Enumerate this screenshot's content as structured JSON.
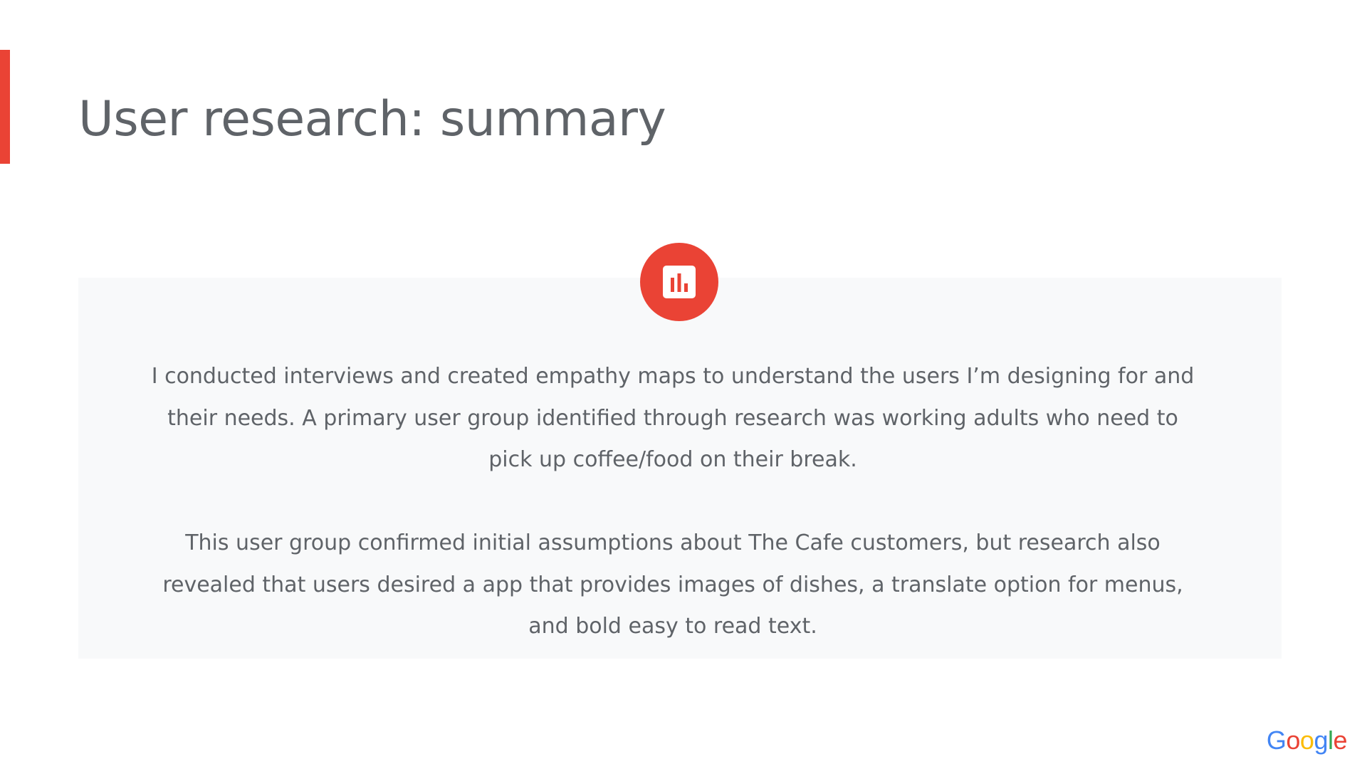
{
  "slide": {
    "title": "User research: summary",
    "accent_color": "#ea4335",
    "panel_background": "#f8f9fa",
    "icon": "bar-chart-icon",
    "paragraphs": [
      "I conducted interviews and created empathy maps to understand the users I’m designing for and their needs. A primary user group identified through research was working adults who need to pick up coffee/food on their break.",
      "This user group confirmed initial assumptions about The Cafe customers, but research also revealed that users desired a app that provides images of dishes, a translate option for menus, and bold easy to read text."
    ]
  },
  "branding": {
    "logo_text": "Google",
    "logo_letters": [
      "G",
      "o",
      "o",
      "g",
      "l",
      "e"
    ],
    "logo_colors": [
      "#4285f4",
      "#ea4335",
      "#fbbc05",
      "#4285f4",
      "#34a853",
      "#ea4335"
    ]
  }
}
